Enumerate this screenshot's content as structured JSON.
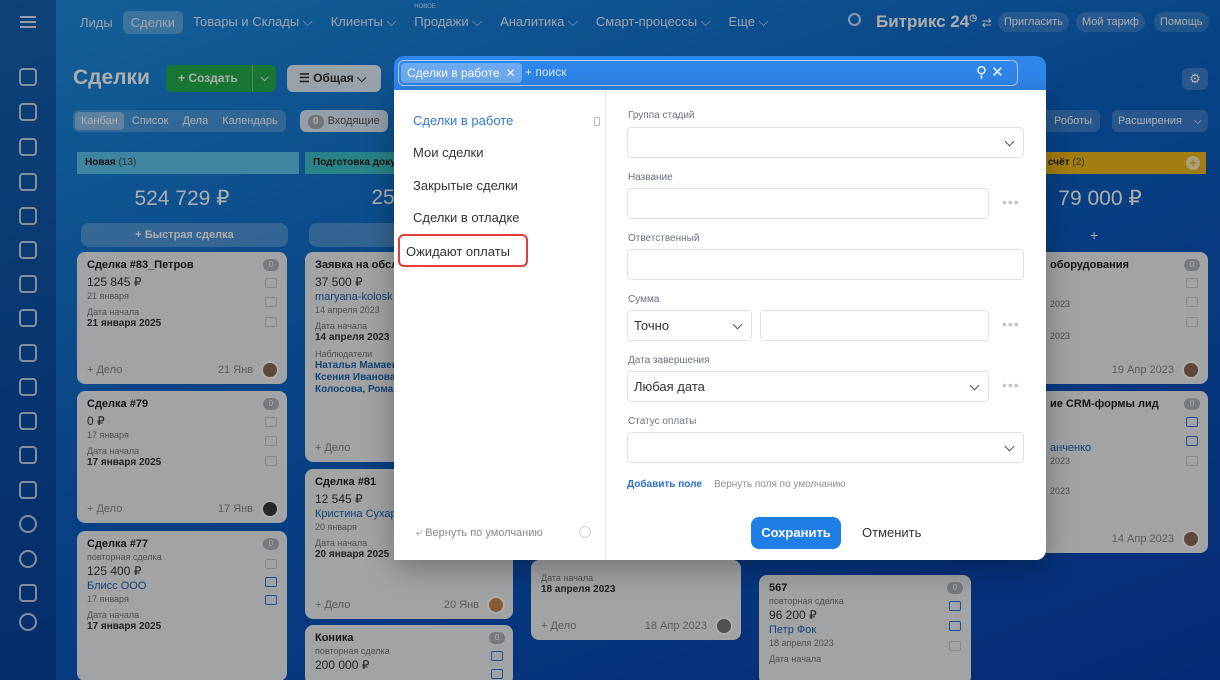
{
  "nav": {
    "items": [
      "Лиды",
      "Сделки",
      "Товары и Склады",
      "Клиенты",
      "Продажи",
      "Аналитика",
      "Смарт-процессы",
      "Еще"
    ],
    "new_badge": "НОВОЕ",
    "brand": "Битрикс 24",
    "invite": "Пригласить",
    "tariff": "Мой тариф",
    "help": "Помощь"
  },
  "header": {
    "title": "Сделки",
    "create": "Создать",
    "filter": "Общая"
  },
  "views": [
    "Канбан",
    "Список",
    "Дела",
    "Календарь"
  ],
  "incoming": {
    "count": "0",
    "label": "Входящие"
  },
  "robots": "Роботы",
  "extensions": "Расширения",
  "columns": [
    {
      "name": "Новая",
      "count": "(13)",
      "sum": "524 729 ₽",
      "quick": "Быстрая сделка",
      "color": "#5ec3ee"
    },
    {
      "name": "Подготовка доку",
      "sum": "25",
      "color": "#3ec2c9"
    },
    {
      "name": "счёт",
      "count": "(2)",
      "sum": "79 000 ₽",
      "color": "#f2b81b"
    }
  ],
  "cards_col1": [
    {
      "title": "Сделка #83_Петров",
      "amount": "125 845 ₽",
      "sub": "21 января",
      "start_label": "Дата начала",
      "start": "21 января 2025",
      "add": "+ Дело",
      "date": "21 Янв",
      "badge": "0"
    },
    {
      "title": "Сделка #79",
      "amount": "0 ₽",
      "sub": "17 января",
      "start_label": "Дата начала",
      "start": "17 января 2025",
      "add": "+ Дело",
      "date": "17 Янв",
      "badge": "0"
    },
    {
      "title": "Сделка #77",
      "repeat": "повторная сделка",
      "amount": "125 400 ₽",
      "link": "Блисс ООО",
      "sub": "17 января",
      "start_label": "Дата начала",
      "start": "17 января 2025",
      "add": "+ Дело",
      "date": "17 Янв",
      "badge": "0"
    }
  ],
  "cards_col2": [
    {
      "title": "Заявка на обсл",
      "amount": "37 500 ₽",
      "link": "maryana-kolosk",
      "sub": "14 апреля 2023",
      "start_label": "Дата начала",
      "start": "14 апреля 2023",
      "obs_label": "Наблюдатели",
      "obs": [
        "Наталья Мамаев",
        "Ксения Иванова",
        "Колосова, Рома"
      ],
      "add": "+ Дело"
    },
    {
      "title": "Сделка #81",
      "amount": "12 545 ₽",
      "link": "Кристина Сухар",
      "sub": "20 января",
      "start_label": "Дата начала",
      "start": "20 января 2025",
      "add": "+ Дело",
      "date": "20 Янв"
    },
    {
      "title": "Коника",
      "repeat": "повторная сделка",
      "amount": "200 000 ₽",
      "badge": "0"
    }
  ],
  "cards_col3": [
    {
      "start_label": "Дата начала",
      "start": "18 апреля 2023",
      "add": "+ Дело",
      "date": "18 Апр 2023"
    }
  ],
  "cards_col4": [
    {
      "title": "567",
      "repeat": "повторная сделка",
      "amount": "96 200 ₽",
      "link": "Петр Фок",
      "sub": "18 апреля 2023",
      "start_label": "Дата начала",
      "badge": "0"
    }
  ],
  "cards_col5": [
    {
      "title": "оборудования",
      "sub1": "2023",
      "sub2": "2023",
      "date": "19 Апр 2023",
      "badge": "0"
    },
    {
      "title": "ие CRM-формы лид",
      "link": "анченко",
      "sub1": "2023",
      "sub2": "2023",
      "date": "14 Апр 2023",
      "badge": "0"
    }
  ],
  "popup": {
    "chip": "Сделки в работе",
    "search_placeholder": "+ поиск",
    "presets": [
      "Сделки в работе",
      "Мои сделки",
      "Закрытые сделки",
      "Сделки в отладке"
    ],
    "new_preset_value": "Ожидают оплаты",
    "reset": "Вернуть по умолчанию",
    "fields": [
      {
        "label": "Группа стадий",
        "value": ""
      },
      {
        "label": "Название",
        "value": ""
      },
      {
        "label": "Ответственный",
        "value": ""
      },
      {
        "label": "Сумма",
        "value": "Точно"
      },
      {
        "label": "Дата завершения",
        "value": "Любая дата"
      },
      {
        "label": "Статус оплаты",
        "value": ""
      }
    ],
    "add_field": "Добавить поле",
    "restore_fields": "Вернуть поля по умолчанию",
    "save": "Сохранить",
    "cancel": "Отменить"
  }
}
